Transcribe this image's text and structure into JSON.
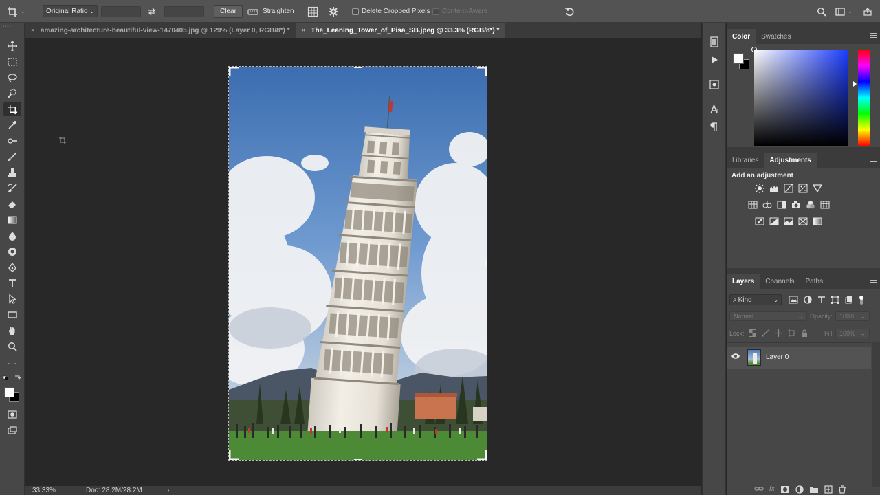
{
  "options_bar": {
    "ratio": "Original Ratio",
    "clear": "Clear",
    "straighten": "Straighten",
    "delete_cropped": "Delete Cropped Pixels",
    "content_aware": "Content-Aware"
  },
  "tabs": [
    {
      "label": "amazing-architecture-beautiful-view-1470405.jpg @ 129% (Layer 0, RGB/8*) *",
      "active": false
    },
    {
      "label": "The_Leaning_Tower_of_Pisa_SB.jpeg @ 33.3% (RGB/8*) *",
      "active": true
    }
  ],
  "close_glyph": "×",
  "status": {
    "zoom": "33.33%",
    "doc": "Doc: 28.2M/28.2M",
    "arrow": "›"
  },
  "color_panel": {
    "tab_color": "Color",
    "tab_swatches": "Swatches"
  },
  "adjustments_panel": {
    "tab_libraries": "Libraries",
    "tab_adjustments": "Adjustments",
    "title": "Add an adjustment"
  },
  "layers_panel": {
    "tab_layers": "Layers",
    "tab_channels": "Channels",
    "tab_paths": "Paths",
    "kind": "Kind",
    "blend": "Normal",
    "opacity_label": "Opacity:",
    "opacity_value": "100%",
    "lock_label": "Lock:",
    "fill_label": "Fill:",
    "fill_value": "100%",
    "layer_name": "Layer 0"
  },
  "colors": {
    "accent": "#4a4a4a",
    "panel": "#474747",
    "canvas": "#282828"
  }
}
